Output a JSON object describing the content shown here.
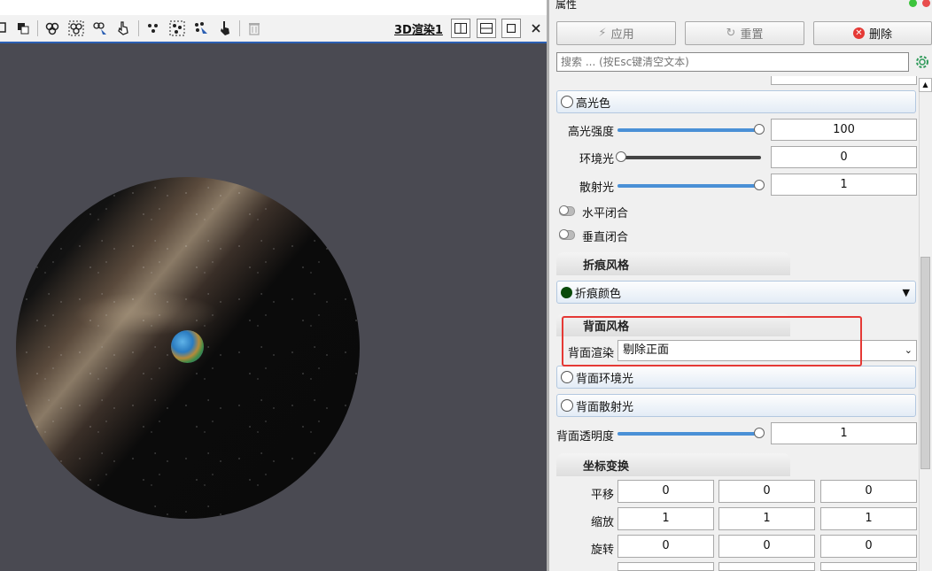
{
  "view": {
    "title": "3D渲染1",
    "toolbar_icons": [
      "pan-icon",
      "copy-icon",
      "select-cells-icon",
      "select-cells-frustum-icon",
      "select-cells-interactive-icon",
      "hover-cells-icon",
      "select-points-icon",
      "select-points-frustum-icon",
      "select-points-interactive-icon",
      "hover-points-icon",
      "clear-selection-icon"
    ]
  },
  "panel": {
    "title": "属性",
    "apply_label": "应用",
    "reset_label": "重置",
    "delete_label": "删除",
    "search_placeholder": "搜索 ... (按Esc键清空文本)",
    "specular_color_label": "高光色",
    "specular_strength": {
      "label": "高光强度",
      "value": "100",
      "fraction": 1.0
    },
    "ambient": {
      "label": "环境光",
      "value": "0",
      "fraction": 0.0
    },
    "diffuse": {
      "label": "散射光",
      "value": "1",
      "fraction": 1.0
    },
    "h_closed": "水平闭合",
    "v_closed": "垂直闭合",
    "crease_style": "折痕风格",
    "crease_color": "折痕颜色",
    "back_style": "背面风格",
    "back_render": {
      "label": "背面渲染",
      "value": "剔除正面"
    },
    "back_ambient": "背面环境光",
    "back_diffuse": "背面散射光",
    "back_opacity": {
      "label": "背面透明度",
      "value": "1",
      "fraction": 1.0
    },
    "transform": "坐标变换",
    "translate": {
      "label": "平移",
      "values": [
        "0",
        "0",
        "0"
      ]
    },
    "scale": {
      "label": "缩放",
      "values": [
        "1",
        "1",
        "1"
      ]
    },
    "rotate": {
      "label": "旋转",
      "values": [
        "0",
        "0",
        "0"
      ]
    }
  },
  "colors": {
    "accent": "#4a90d6",
    "highlight": "#e53935",
    "crease": "#0a4a0a"
  }
}
